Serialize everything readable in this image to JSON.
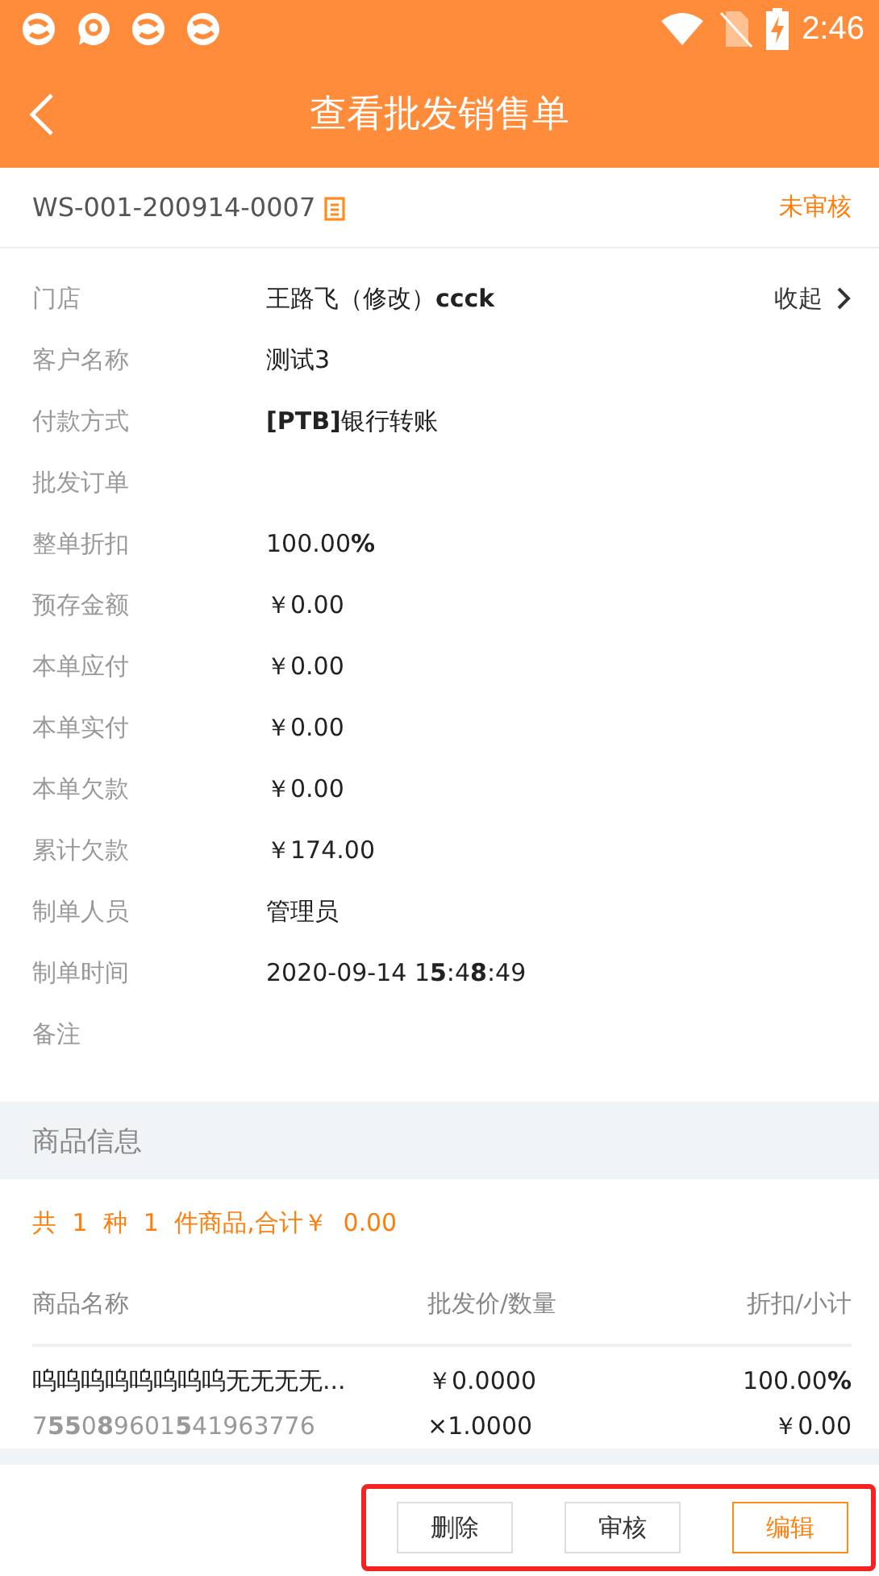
{
  "status_bar": {
    "time": "2:46"
  },
  "header": {
    "title": "查看批发销售单"
  },
  "order": {
    "number": "WS-001-200914-0007",
    "status": "未审核"
  },
  "details": [
    {
      "label": "门店",
      "value": "王路飞（修改）**ccck**",
      "toggle": "收起"
    },
    {
      "label": "客户名称",
      "value": "测试3"
    },
    {
      "label": "付款方式",
      "value": "**[PTB]**银行转账"
    },
    {
      "label": "批发订单"
    },
    {
      "label": "整单折扣",
      "value": "100.00**%**"
    },
    {
      "label": "预存金额",
      "value": "￥0.00"
    },
    {
      "label": "本单应付",
      "value": "￥0.00"
    },
    {
      "label": "本单实付",
      "value": "￥0.00"
    },
    {
      "label": "本单欠款",
      "value": "￥0.00"
    },
    {
      "label": "累计欠款",
      "value": "￥174.00"
    },
    {
      "label": "制单人员",
      "value": "管理员"
    },
    {
      "label": "制单时间",
      "value": "2020-09-14 1**5**:4**8**:49"
    },
    {
      "label": "备注"
    }
  ],
  "goods": {
    "section_title": "商品信息",
    "summary": "共 1 种 1 件商品,合计￥ 0.00",
    "columns": [
      "商品名称",
      "批发价/数量",
      "折扣/小计"
    ],
    "items": [
      {
        "name": "呜呜呜呜呜呜呜呜无无无无...",
        "barcode": "7**55**0**8**9601**5**41963776",
        "price": "￥0.0000",
        "quantity": "×1.0000",
        "discount": "100.00**%**",
        "subtotal": "￥0.00"
      }
    ]
  },
  "actions": {
    "highlighted": true,
    "buttons": [
      {
        "label": "删除",
        "primary": false
      },
      {
        "label": "审核",
        "primary": false
      },
      {
        "label": "编辑",
        "primary": true
      }
    ]
  }
}
